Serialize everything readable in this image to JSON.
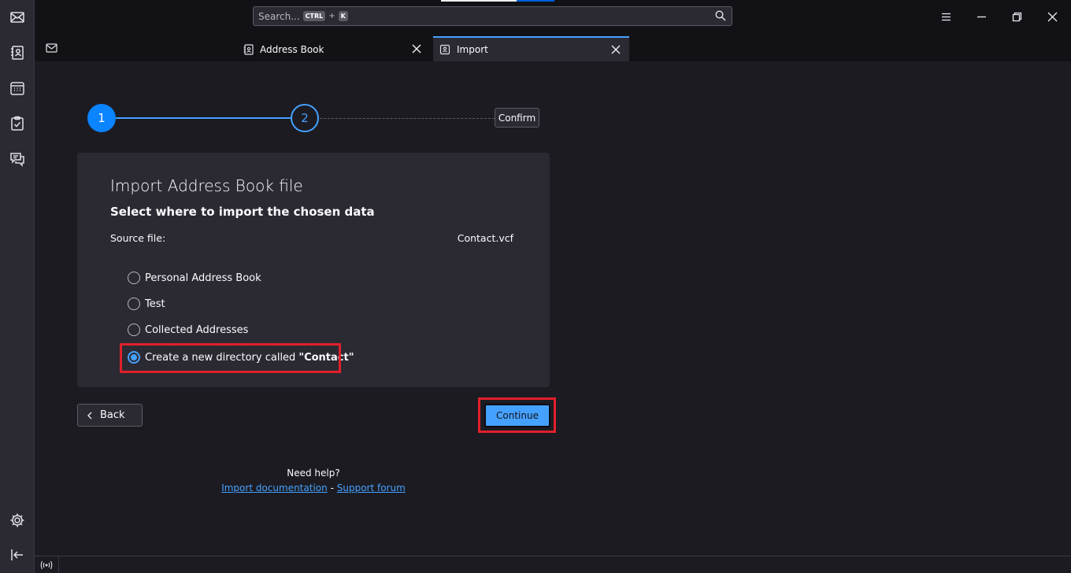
{
  "titlebar": {
    "search_placeholder": "Search...",
    "shortcut_key1": "CTRL",
    "shortcut_plus": "+",
    "shortcut_key2": "K"
  },
  "tabs": [
    {
      "label": "Address Book"
    },
    {
      "label": "Import"
    }
  ],
  "stepper": {
    "step1": "1",
    "step2": "2",
    "confirm": "Confirm"
  },
  "card": {
    "title": "Import Address Book file",
    "subtitle": "Select where to import the chosen data",
    "source_label": "Source file:",
    "source_value": "Contact.vcf",
    "options": [
      {
        "label": "Personal Address Book",
        "checked": false
      },
      {
        "label": "Test",
        "checked": false
      },
      {
        "label": "Collected Addresses",
        "checked": false
      },
      {
        "label": "Create a new directory called",
        "bold": "\"Contact\"",
        "checked": true
      }
    ]
  },
  "buttons": {
    "back": "Back",
    "continue": "Continue"
  },
  "help": {
    "title": "Need help?",
    "docs_link": "Import documentation",
    "separator": "-",
    "forum_link": "Support forum"
  },
  "colors": {
    "accent": "#45a1ff",
    "highlight": "#e0202a",
    "background": "#1c1b22",
    "card": "#2b2a33"
  }
}
